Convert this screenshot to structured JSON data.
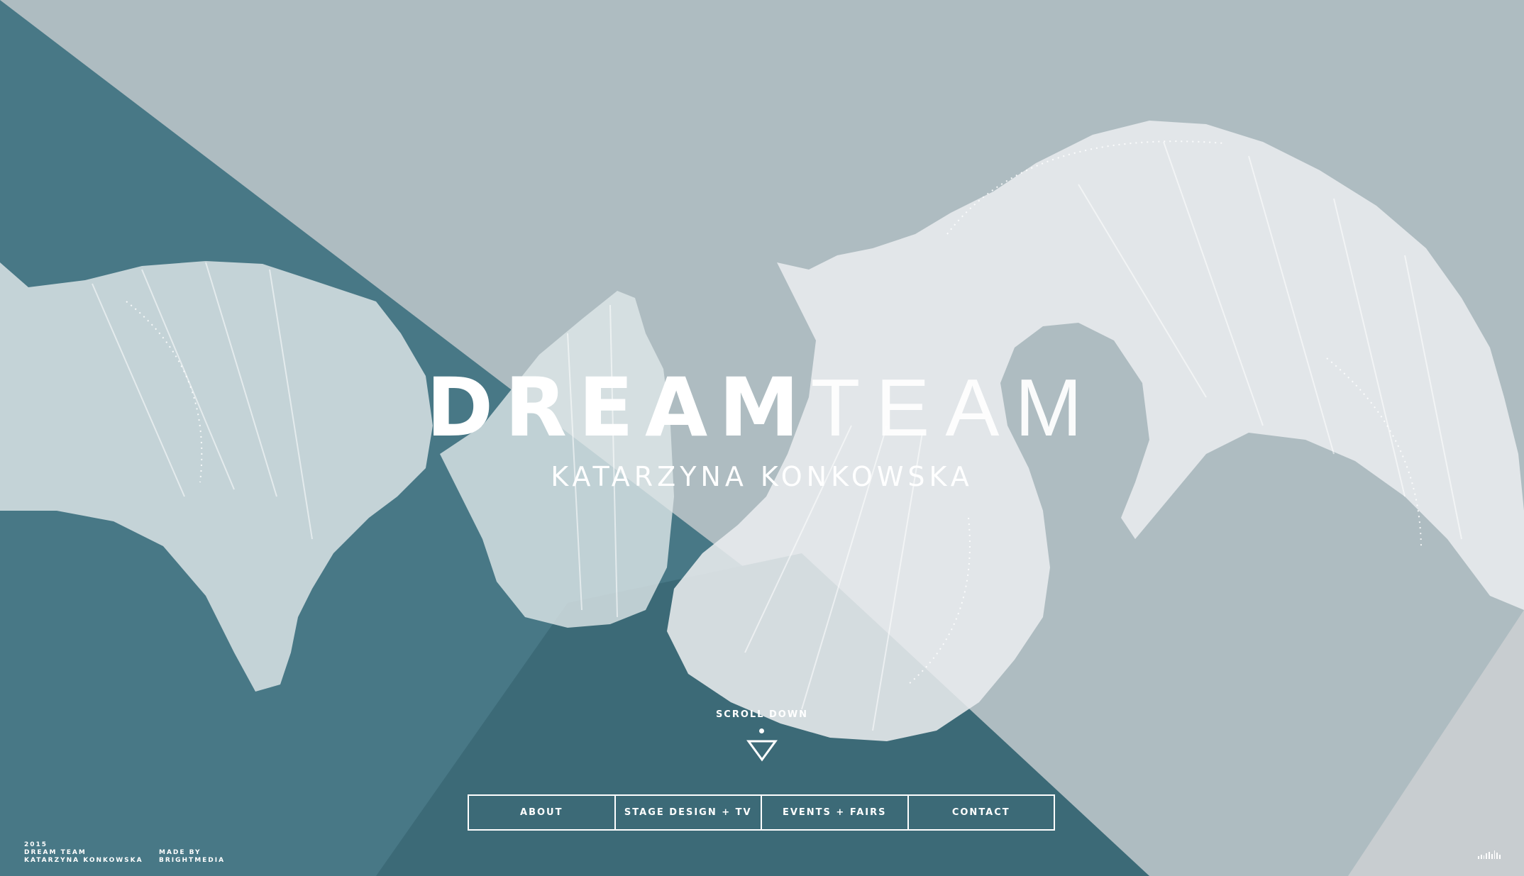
{
  "hero": {
    "title_bold": "DREAM",
    "title_light": "TEAM",
    "subtitle": "KATARZYNA KONKOWSKA"
  },
  "scroll": {
    "label": "SCROLL DOWN",
    "icon": "triangle-down-icon"
  },
  "nav": {
    "items": [
      {
        "label": "ABOUT"
      },
      {
        "label": "STAGE DESIGN + TV"
      },
      {
        "label": "EVENTS + FAIRS"
      },
      {
        "label": "CONTACT"
      }
    ]
  },
  "footer": {
    "year": "2015",
    "brand": "DREAM TEAM",
    "author": "KATARZYNA KONKOWSKA",
    "made_by_label": "MADE BY",
    "made_by_name": "BRIGHTMEDIA"
  },
  "sound_icon": "sound-bars-icon",
  "colors": {
    "background_light": "#aebcc1",
    "background_dark": "#487886",
    "background_darker": "#3c6a77",
    "paper": "#e9ecee",
    "text": "#ffffff"
  }
}
